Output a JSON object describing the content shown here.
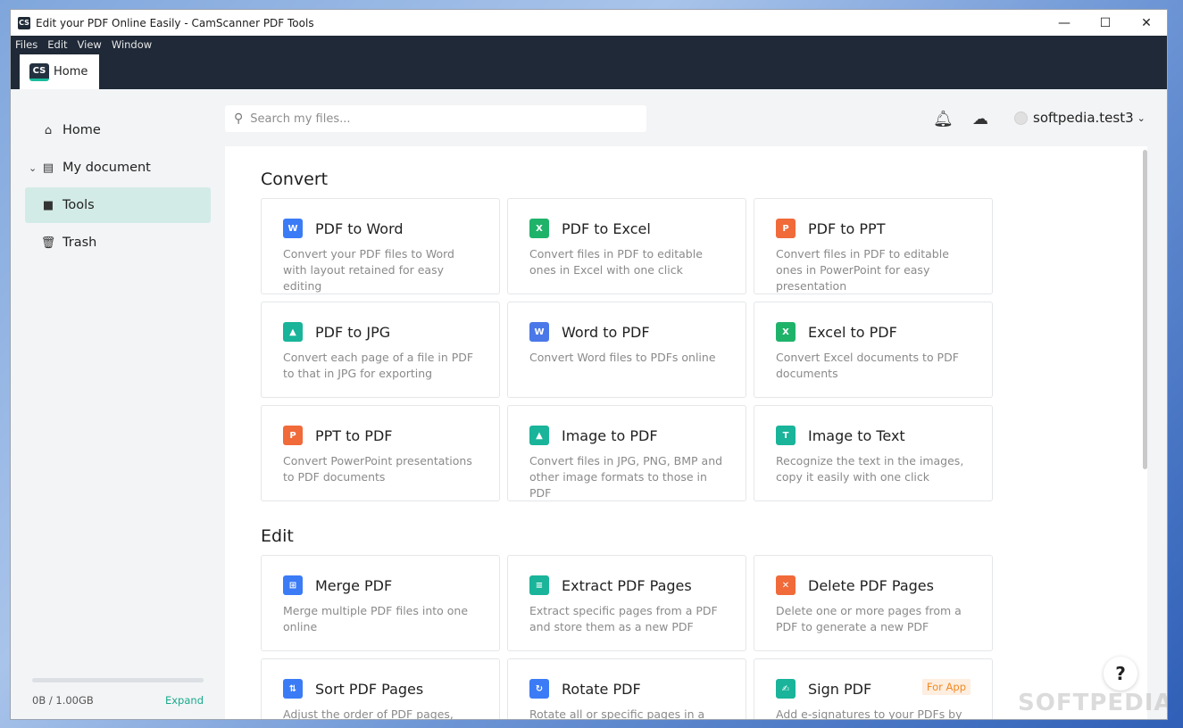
{
  "window": {
    "title": "Edit your PDF Online Easily - CamScanner PDF Tools",
    "app_icon": "CS",
    "controls": {
      "minimize": "—",
      "maximize": "☐",
      "close": "✕"
    }
  },
  "menu": [
    "Files",
    "Edit",
    "View",
    "Window"
  ],
  "tab": {
    "logo": "CS",
    "label": "Home"
  },
  "sidebar": {
    "items": [
      {
        "label": "Home",
        "icon": "home-icon"
      },
      {
        "label": "My document",
        "icon": "document-icon"
      },
      {
        "label": "Tools",
        "icon": "toolbox-icon"
      },
      {
        "label": "Trash",
        "icon": "trash-icon"
      }
    ],
    "active": "Tools",
    "storage": {
      "used": "0B / 1.00GB",
      "expand_label": "Expand",
      "fill_fraction": 0.0
    }
  },
  "header": {
    "search_placeholder": "Search my files...",
    "user": "softpedia.test3"
  },
  "sections": [
    {
      "title": "Convert",
      "tools": [
        {
          "title": "PDF to Word",
          "desc": "Convert your PDF files to Word with layout retained for easy editing",
          "icon": "word-icon",
          "color": "#3b7bf6",
          "glyph": "W"
        },
        {
          "title": "PDF to Excel",
          "desc": "Convert files in PDF to editable ones in Excel with one click",
          "icon": "excel-icon",
          "color": "#1fb36a",
          "glyph": "X"
        },
        {
          "title": "PDF to PPT",
          "desc": "Convert files in PDF to editable ones in PowerPoint for easy presentation",
          "icon": "ppt-icon",
          "color": "#f06a3a",
          "glyph": "P"
        },
        {
          "title": "PDF to JPG",
          "desc": "Convert each page of a file in PDF to that in JPG for exporting",
          "icon": "jpg-icon",
          "color": "#19b49a",
          "glyph": "▲"
        },
        {
          "title": "Word to PDF",
          "desc": "Convert Word files to PDFs online",
          "icon": "word-to-pdf-icon",
          "color": "#4a78e8",
          "glyph": "W"
        },
        {
          "title": "Excel to PDF",
          "desc": "Convert Excel documents to PDF documents",
          "icon": "excel-to-pdf-icon",
          "color": "#1fb36a",
          "glyph": "X"
        },
        {
          "title": "PPT to PDF",
          "desc": "Convert PowerPoint presentations to PDF documents",
          "icon": "ppt-to-pdf-icon",
          "color": "#f06a3a",
          "glyph": "P"
        },
        {
          "title": "Image to PDF",
          "desc": "Convert files in JPG, PNG, BMP and other image formats to those in PDF",
          "icon": "image-to-pdf-icon",
          "color": "#19b49a",
          "glyph": "▲"
        },
        {
          "title": "Image to Text",
          "desc": "Recognize the text in the images, copy it easily with one click",
          "icon": "image-to-text-icon",
          "color": "#19b49a",
          "glyph": "T"
        }
      ]
    },
    {
      "title": "Edit",
      "tools": [
        {
          "title": "Merge PDF",
          "desc": "Merge multiple PDF files into one online",
          "icon": "merge-icon",
          "color": "#3b7bf6",
          "glyph": "⊞"
        },
        {
          "title": "Extract PDF Pages",
          "desc": "Extract specific pages from a PDF and store them as a new PDF",
          "icon": "extract-icon",
          "color": "#19b49a",
          "glyph": "≡"
        },
        {
          "title": "Delete PDF Pages",
          "desc": "Delete one or more pages from a PDF to generate a new PDF",
          "icon": "delete-pages-icon",
          "color": "#f06a3a",
          "glyph": "✕"
        },
        {
          "title": "Sort PDF Pages",
          "desc": "Adjust the order of PDF pages, delete",
          "icon": "sort-icon",
          "color": "#3b7bf6",
          "glyph": "⇅"
        },
        {
          "title": "Rotate PDF",
          "desc": "Rotate all or specific pages in a PDF",
          "icon": "rotate-icon",
          "color": "#3b7bf6",
          "glyph": "↻"
        },
        {
          "title": "Sign PDF",
          "desc": "Add e-signatures to your PDFs by",
          "icon": "sign-icon",
          "color": "#19b49a",
          "glyph": "✍",
          "badge": "For App"
        }
      ]
    }
  ],
  "help_label": "?",
  "watermark": "SOFTPEDIA"
}
